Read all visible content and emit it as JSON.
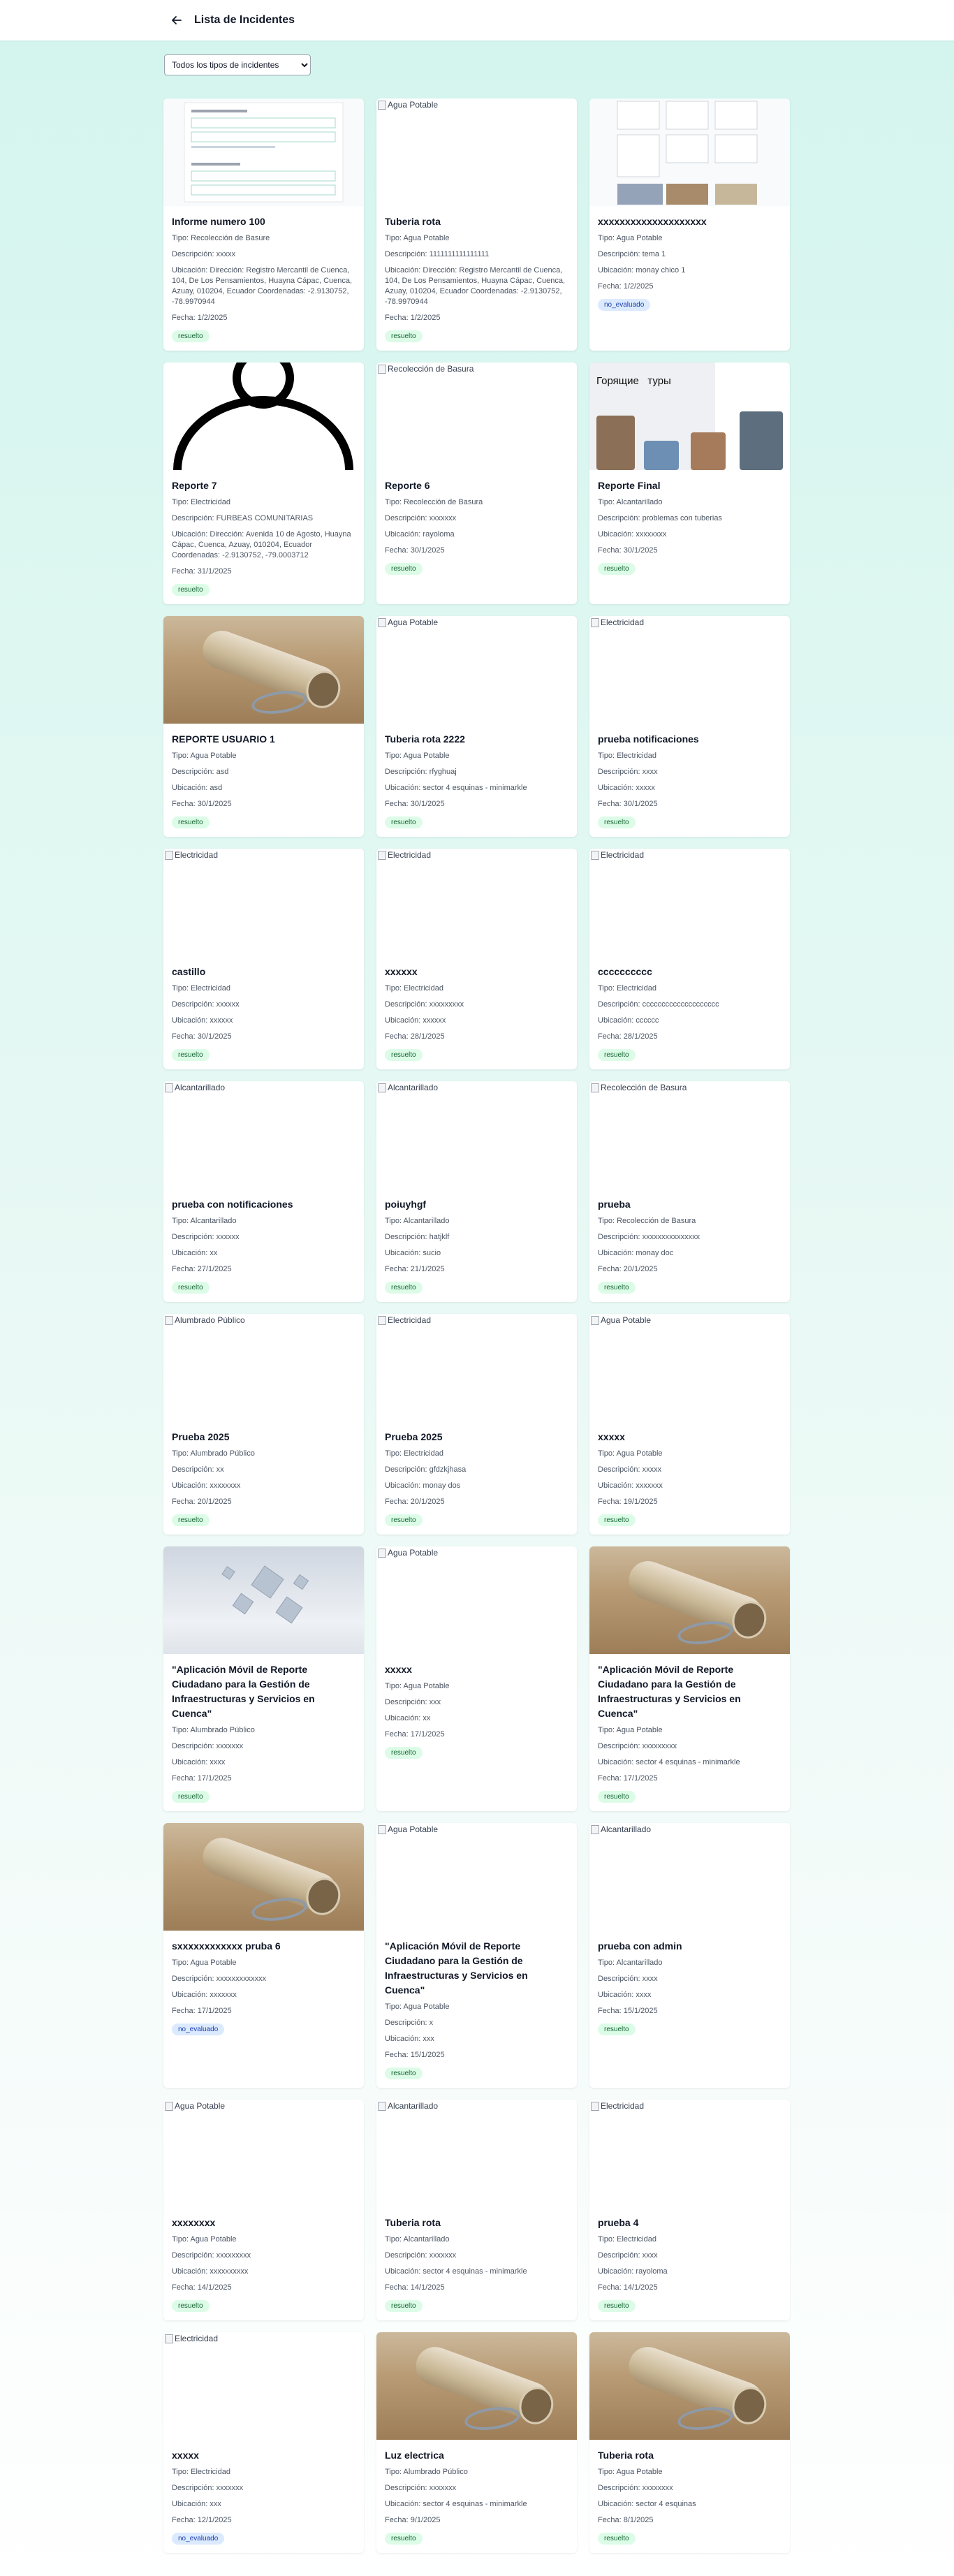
{
  "header": {
    "title": "Lista de Incidentes"
  },
  "filter": {
    "selected": "Todos los tipos de incidentes"
  },
  "labels": {
    "tipo": "Tipo:",
    "descripcion": "Descripción:",
    "ubicacion": "Ubicación:",
    "fecha": "Fecha:"
  },
  "incidents": [
    {
      "title": "Informe numero 100",
      "tipo": "Recolección de Basure",
      "descripcion": "xxxxx",
      "ubicacion": "Dirección: Registro Mercantil de Cuenca, 104, De Los Pensamientos, Huayna Cápac, Cuenca, Azuay, 010204, Ecuador Coordenadas: -2.9130752, -78.9970944",
      "fecha": "1/2/2025",
      "estado": "resuelto",
      "image": "document-screenshot",
      "alt": ""
    },
    {
      "title": "Tuberia rota",
      "tipo": "Agua Potable",
      "descripcion": "1111111111111111",
      "ubicacion": "Dirección: Registro Mercantil de Cuenca, 104, De Los Pensamientos, Huayna Cápac, Cuenca, Azuay, 010204, Ecuador Coordenadas: -2.9130752, -78.9970944",
      "fecha": "1/2/2025",
      "estado": "resuelto",
      "image": "broken",
      "alt": "Agua Potable"
    },
    {
      "title": "xxxxxxxxxxxxxxxxxxxx",
      "tipo": "Agua Potable",
      "descripcion": "tema 1",
      "ubicacion": "monay chico 1",
      "fecha": "1/2/2025",
      "estado": "no_evaluado",
      "image": "document-grid",
      "alt": ""
    },
    {
      "title": "Reporte 7",
      "tipo": "Electricidad",
      "descripcion": "FURBEAS COMUNITARIAS",
      "ubicacion": "Dirección: Avenida 10 de Agosto, Huayna Cápac, Cuenca, Azuay, 010204, Ecuador Coordenadas: -2.9130752, -79.0003712",
      "fecha": "31/1/2025",
      "estado": "resuelto",
      "image": "person-icon",
      "alt": ""
    },
    {
      "title": "Reporte 6",
      "tipo": "Recolección de Basura",
      "descripcion": "xxxxxxx",
      "ubicacion": "rayoloma",
      "fecha": "30/1/2025",
      "estado": "resuelto",
      "image": "broken",
      "alt": "Recolección de Basura"
    },
    {
      "title": "Reporte Final",
      "tipo": "Alcantarillado",
      "descripcion": "problemas con tuberias",
      "ubicacion": "xxxxxxxx",
      "fecha": "30/1/2025",
      "estado": "resuelto",
      "image": "tour-collage",
      "alt": "",
      "overlay": "Горящие   туры"
    },
    {
      "title": "REPORTE USUARIO 1",
      "tipo": "Agua Potable",
      "descripcion": "asd",
      "ubicacion": "asd",
      "fecha": "30/1/2025",
      "estado": "resuelto",
      "image": "pipe-photo",
      "alt": ""
    },
    {
      "title": "Tuberia rota 2222",
      "tipo": "Agua Potable",
      "descripcion": "rfyghuaj",
      "ubicacion": "sector 4 esquinas - minimarkle",
      "fecha": "30/1/2025",
      "estado": "resuelto",
      "image": "broken",
      "alt": "Agua Potable"
    },
    {
      "title": "prueba notificaciones",
      "tipo": "Electricidad",
      "descripcion": "xxxx",
      "ubicacion": "xxxxx",
      "fecha": "30/1/2025",
      "estado": "resuelto",
      "image": "broken",
      "alt": "Electricidad"
    },
    {
      "title": "castillo",
      "tipo": "Electricidad",
      "descripcion": "xxxxxx",
      "ubicacion": "xxxxxx",
      "fecha": "30/1/2025",
      "estado": "resuelto",
      "image": "broken",
      "alt": "Electricidad"
    },
    {
      "title": "xxxxxx",
      "tipo": "Electricidad",
      "descripcion": "xxxxxxxxx",
      "ubicacion": "xxxxxx",
      "fecha": "28/1/2025",
      "estado": "resuelto",
      "image": "broken",
      "alt": "Electricidad"
    },
    {
      "title": "cccccccccc",
      "tipo": "Electricidad",
      "descripcion": "cccccccccccccccccccc",
      "ubicacion": "cccccc",
      "fecha": "28/1/2025",
      "estado": "resuelto",
      "image": "broken",
      "alt": "Electricidad"
    },
    {
      "title": "prueba con notificaciones",
      "tipo": "Alcantarillado",
      "descripcion": "xxxxxx",
      "ubicacion": "xx",
      "fecha": "27/1/2025",
      "estado": "resuelto",
      "image": "broken",
      "alt": "Alcantarillado"
    },
    {
      "title": "poiuyhgf",
      "tipo": "Alcantarillado",
      "descripcion": "hatjklf",
      "ubicacion": "sucio",
      "fecha": "21/1/2025",
      "estado": "resuelto",
      "image": "broken",
      "alt": "Alcantarillado"
    },
    {
      "title": "prueba",
      "tipo": "Recolección de Basura",
      "descripcion": "xxxxxxxxxxxxxxx",
      "ubicacion": "monay doc",
      "fecha": "20/1/2025",
      "estado": "resuelto",
      "image": "broken",
      "alt": "Recolección de Basura"
    },
    {
      "title": "Prueba 2025",
      "tipo": "Alumbrado Público",
      "descripcion": "xx",
      "ubicacion": "xxxxxxxx",
      "fecha": "20/1/2025",
      "estado": "resuelto",
      "image": "broken",
      "alt": "Alumbrado Público"
    },
    {
      "title": "Prueba 2025",
      "tipo": "Electricidad",
      "descripcion": "gfdzkjhasa",
      "ubicacion": "monay dos",
      "fecha": "20/1/2025",
      "estado": "resuelto",
      "image": "broken",
      "alt": "Electricidad"
    },
    {
      "title": "xxxxx",
      "tipo": "Agua Potable",
      "descripcion": "xxxxx",
      "ubicacion": "xxxxxxx",
      "fecha": "19/1/2025",
      "estado": "resuelto",
      "image": "broken",
      "alt": "Agua Potable"
    },
    {
      "title": "\"Aplicación Móvil de Reporte Ciudadano para la Gestión de Infraestructuras y Servicios en Cuenca\"",
      "tipo": "Alumbrado Público",
      "descripcion": "xxxxxxx",
      "ubicacion": "xxxx",
      "fecha": "17/1/2025",
      "estado": "resuelto",
      "image": "cubes-photo",
      "alt": ""
    },
    {
      "title": "xxxxx",
      "tipo": "Agua Potable",
      "descripcion": "xxx",
      "ubicacion": "xx",
      "fecha": "17/1/2025",
      "estado": "resuelto",
      "image": "broken",
      "alt": "Agua Potable"
    },
    {
      "title": "\"Aplicación Móvil de Reporte Ciudadano para la Gestión de Infraestructuras y Servicios en Cuenca\"",
      "tipo": "Agua Potable",
      "descripcion": "xxxxxxxxx",
      "ubicacion": "sector 4 esquinas - minimarkle",
      "fecha": "17/1/2025",
      "estado": "resuelto",
      "image": "pipe-photo",
      "alt": ""
    },
    {
      "title": "sxxxxxxxxxxxx pruba 6",
      "tipo": "Agua Potable",
      "descripcion": "xxxxxxxxxxxxx",
      "ubicacion": "xxxxxxx",
      "fecha": "17/1/2025",
      "estado": "no_evaluado",
      "image": "pipe-photo",
      "alt": ""
    },
    {
      "title": "\"Aplicación Móvil de Reporte Ciudadano para la Gestión de Infraestructuras y Servicios en Cuenca\"",
      "tipo": "Agua Potable",
      "descripcion": "x",
      "ubicacion": "xxx",
      "fecha": "15/1/2025",
      "estado": "resuelto",
      "image": "broken",
      "alt": "Agua Potable"
    },
    {
      "title": "prueba con admin",
      "tipo": "Alcantarillado",
      "descripcion": "xxxx",
      "ubicacion": "xxxx",
      "fecha": "15/1/2025",
      "estado": "resuelto",
      "image": "broken",
      "alt": "Alcantarillado"
    },
    {
      "title": "xxxxxxxx",
      "tipo": "Agua Potable",
      "descripcion": "xxxxxxxxx",
      "ubicacion": "xxxxxxxxxx",
      "fecha": "14/1/2025",
      "estado": "resuelto",
      "image": "broken",
      "alt": "Agua Potable"
    },
    {
      "title": "Tuberia rota",
      "tipo": "Alcantarillado",
      "descripcion": "xxxxxxx",
      "ubicacion": "sector 4 esquinas - minimarkle",
      "fecha": "14/1/2025",
      "estado": "resuelto",
      "image": "broken",
      "alt": "Alcantarillado"
    },
    {
      "title": "prueba 4",
      "tipo": "Electricidad",
      "descripcion": "xxxx",
      "ubicacion": "rayoloma",
      "fecha": "14/1/2025",
      "estado": "resuelto",
      "image": "broken",
      "alt": "Electricidad"
    },
    {
      "title": "xxxxx",
      "tipo": "Electricidad",
      "descripcion": "xxxxxxx",
      "ubicacion": "xxx",
      "fecha": "12/1/2025",
      "estado": "no_evaluado",
      "image": "broken",
      "alt": "Electricidad"
    },
    {
      "title": "Luz electrica",
      "tipo": "Alumbrado Público",
      "descripcion": "xxxxxxx",
      "ubicacion": "sector 4 esquinas - minimarkle",
      "fecha": "9/1/2025",
      "estado": "resuelto",
      "image": "pipe-photo",
      "alt": ""
    },
    {
      "title": "Tuberia rota",
      "tipo": "Agua Potable",
      "descripcion": "xxxxxxxx",
      "ubicacion": "sector 4 esquinas",
      "fecha": "8/1/2025",
      "estado": "resuelto",
      "image": "pipe-photo",
      "alt": ""
    }
  ],
  "colors": {
    "background_top": "#d4f5ee",
    "resuelto_bg": "#dcfce7",
    "resuelto_text": "#166534",
    "no_evaluado_bg": "#dbeafe",
    "no_evaluado_text": "#1e40af"
  }
}
